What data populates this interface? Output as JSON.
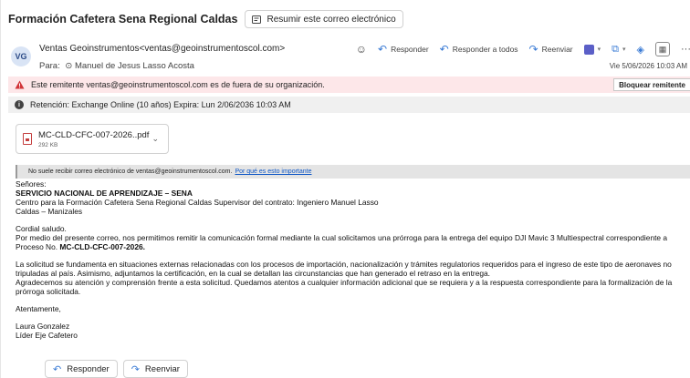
{
  "email": {
    "subject": "Formación Cafetera Sena Regional Caldas",
    "summarize_label": "Resumir este correo electrónico",
    "avatar_initials": "VG",
    "from": "Ventas Geoinstrumentos<ventas@geoinstrumentoscol.com>",
    "to_prefix": "Para:",
    "to": "Manuel de Jesus Lasso Acosta",
    "date": "Vie 5/06/2026 10:03 AM",
    "actions": {
      "reply": "Responder",
      "reply_all": "Responder a todos",
      "forward": "Reenviar"
    },
    "external_warning": "Este remitente ventas@geoinstrumentoscol.com es de fuera de su organización.",
    "block_label": "Bloquear remitente",
    "retention": "Retención: Exchange Online (10 años) Expira: Lun 2/06/2036 10:03 AM",
    "attachment": {
      "name": "MC-CLD-CFC-007-2026..pdf",
      "size": "292 KB"
    },
    "notice_text": "No suele recibir correo electrónico de ventas@geoinstrumentoscol.com.",
    "notice_link": "Por qué es esto importante",
    "body": {
      "salutation": "Señores:",
      "org": "SERVICIO NACIONAL DE APRENDIZAJE – SENA",
      "center": "Centro para la Formación Cafetera Sena Regional Caldas Supervisor del contrato: Ingeniero Manuel Lasso",
      "city": "Caldas – Manizales",
      "greeting": "Cordial saludo.",
      "p1_line1": "Por medio del presente correo, nos permitimos remitir la comunicación formal mediante la cual solicitamos una prórroga para la entrega del equipo DJI Mavic 3 Multiespectral correspondiente a",
      "p1_line2_prefix": "Proceso No.",
      "p1_line2_bold": "MC-CLD-CFC-007-2026.",
      "p2_line1": "La solicitud se fundamenta en situaciones externas relacionadas con los procesos de importación, nacionalización y trámites regulatorios requeridos para el ingreso de este tipo de aeronaves no",
      "p2_line2": "tripuladas al país. Asimismo, adjuntamos la certificación, en la cual se detallan las circunstancias que han generado el retraso en la entrega.",
      "p2_line3": "Agradecemos su atención y comprensión frente a esta solicitud. Quedamos atentos a cualquier información adicional que se requiera y a la respuesta correspondiente para la formalización de la",
      "p2_line4": "prórroga solicitada.",
      "closing": "Atentamente,",
      "sig_name": "Laura Gonzalez",
      "sig_title": "Líder Eje Cafetero"
    },
    "bottom_reply": "Responder",
    "bottom_forward": "Reenviar"
  },
  "icons": {
    "summarize": "summarize-icon",
    "emoji": "emoji-icon",
    "reply": "reply-icon",
    "reply_all": "reply-all-icon",
    "forward": "forward-icon",
    "warning": "warning-icon",
    "info": "info-icon",
    "pdf": "pdf-file-icon"
  },
  "colors": {
    "warning_bg": "#fde7e9",
    "warning_icon": "#d13438",
    "retention_bg": "#f0f0f0",
    "link": "#0f57c6",
    "accent": "#3a7bd5"
  }
}
